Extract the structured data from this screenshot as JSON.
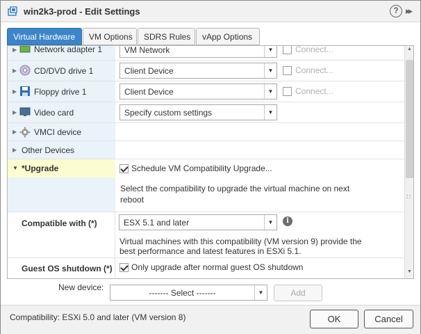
{
  "window": {
    "title": "win2k3-prod - Edit Settings",
    "help": "?",
    "expand": "▸▸"
  },
  "tabs": [
    {
      "label": "Virtual Hardware",
      "active": true
    },
    {
      "label": "VM Options",
      "active": false
    },
    {
      "label": "SDRS Rules",
      "active": false
    },
    {
      "label": "vApp Options",
      "active": false
    }
  ],
  "hardware": {
    "network": {
      "label": "Network adapter 1",
      "value": "VM Network",
      "connect": "Connect..."
    },
    "cddvd": {
      "label": "CD/DVD drive 1",
      "value": "Client Device",
      "connect": "Connect..."
    },
    "floppy": {
      "label": "Floppy drive 1",
      "value": "Client Device",
      "connect": "Connect..."
    },
    "video": {
      "label": "Video card",
      "value": "Specify custom settings"
    },
    "vmci": {
      "label": "VMCI device"
    },
    "other": {
      "label": "Other Devices"
    },
    "upgrade": {
      "label": "*Upgrade",
      "schedule_label": "Schedule VM Compatibility Upgrade...",
      "schedule_checked": true,
      "description": "Select the compatibility to upgrade the virtual machine on next reboot",
      "compatible_label": "Compatible with (*)",
      "compatible_value": "ESX 5.1 and later",
      "compatible_note": "Virtual machines with this compatibility (VM version 9) provide the best performance and latest features in ESXi 5.1.",
      "shutdown_label": "Guest OS shutdown (*)",
      "shutdown_option": "Only upgrade after normal guest OS shutdown",
      "shutdown_checked": true
    }
  },
  "new_device": {
    "label": "New device:",
    "select_value": "------- Select -------",
    "add_label": "Add"
  },
  "status": {
    "compatibility": "Compatibility: ESXi 5.0 and later (VM version 8)"
  },
  "buttons": {
    "ok": "OK",
    "cancel": "Cancel"
  },
  "colors": {
    "accent": "#3c85c8",
    "row_highlight": "#eaf2fa",
    "upgrade_highlight": "#fdfbd0"
  }
}
